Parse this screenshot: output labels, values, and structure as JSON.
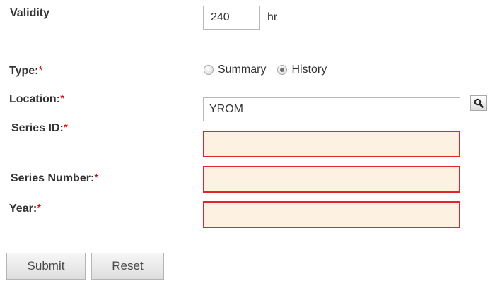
{
  "validity": {
    "label": "Validity",
    "value": "240",
    "unit": "hr"
  },
  "type": {
    "label": "Type:",
    "required_mark": "*",
    "options": [
      {
        "label": "Summary",
        "checked": false
      },
      {
        "label": "History",
        "checked": true
      }
    ]
  },
  "location": {
    "label": "Location:",
    "required_mark": "*",
    "value": "YROM",
    "lookup_icon": "search-icon"
  },
  "series_id": {
    "label": "Series ID:",
    "required_mark": "*",
    "value": ""
  },
  "series_number": {
    "label": "Series Number:",
    "required_mark": "*",
    "value": ""
  },
  "year": {
    "label": "Year:",
    "required_mark": "*",
    "value": ""
  },
  "buttons": {
    "submit": "Submit",
    "reset": "Reset"
  },
  "colors": {
    "invalid_border": "#e0262a",
    "invalid_fill": "#fdf1e2",
    "required": "#cc0000"
  }
}
